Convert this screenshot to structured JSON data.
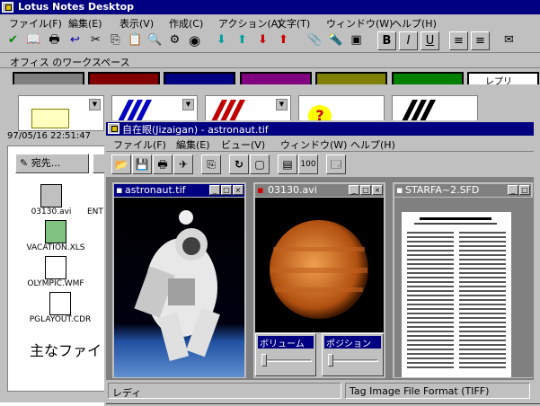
{
  "lotus": {
    "title": "Lotus Notes Desktop",
    "menu": [
      "ファイル(F)",
      "編集(E)",
      "表示(V)",
      "作成(C)",
      "アクション(A)",
      "文字(T)",
      "ウィンドウ(W)",
      "ヘルプ(H)"
    ],
    "workspace_title": "オフィス のワークスペース",
    "tab_colors": [
      "#808080",
      "#800000",
      "#000080",
      "#800080",
      "#808000",
      "#008000",
      "#ffffff"
    ],
    "tab_last_label": "レプリ",
    "date_text": "97/05/16 22:51:47",
    "address_button": "宛先...",
    "files": [
      {
        "name": "03130.avi",
        "icon": "video-icon"
      },
      {
        "name": "VACATION.XLS",
        "icon": "spreadsheet-icon"
      },
      {
        "name": "OLYMPIC.WMF",
        "icon": "document-icon"
      },
      {
        "name": "PGLAYOUT.CDR",
        "icon": "document-icon"
      }
    ],
    "file_name_partial": "ENT",
    "main_file_text": "主なファイ"
  },
  "jizaigan": {
    "title": "自在眼(Jizaigan) - astronaut.tif",
    "menu": [
      "ファイル(F)",
      "編集(E)",
      "ビュー(V)",
      "ウィンドウ(W)",
      "ヘルプ(H)"
    ],
    "zoom_label": "100",
    "windows": {
      "astronaut": {
        "title": "astronaut.tif"
      },
      "video": {
        "title": "03130.avi",
        "volume_label": "ボリューム",
        "position_label": "ポジション"
      },
      "document": {
        "title": "STARFA~2.SFD"
      }
    },
    "status_left": "レディ",
    "status_right": "Tag Image File Format (TIFF)"
  }
}
